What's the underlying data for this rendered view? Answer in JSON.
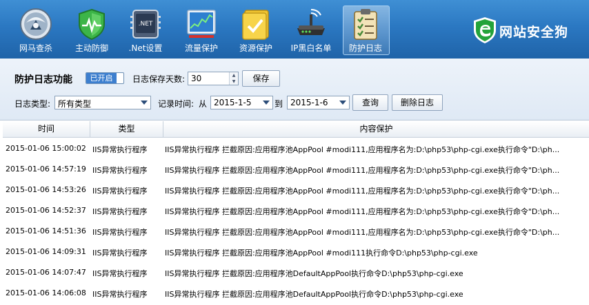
{
  "toolbar": {
    "items": [
      {
        "label": "网马查杀",
        "icon": "shield-globe-icon"
      },
      {
        "label": "主动防御",
        "icon": "green-shield-icon"
      },
      {
        "label": ".Net设置",
        "icon": "dotnet-chip-icon"
      },
      {
        "label": "流量保护",
        "icon": "traffic-chart-icon"
      },
      {
        "label": "资源保护",
        "icon": "folder-check-icon"
      },
      {
        "label": "IP黑白名单",
        "icon": "router-icon"
      },
      {
        "label": "防护日志",
        "icon": "clipboard-checklist-icon"
      }
    ],
    "active_index": 6,
    "brand": "网站安全狗"
  },
  "panel": {
    "title": "防护日志功能",
    "toggle_label": "已开启",
    "days_label": "日志保存天数:",
    "days_value": "30",
    "save_label": "保存",
    "type_label": "日志类型:",
    "type_value": "所有类型",
    "time_label": "记录时间:",
    "from_label": "从",
    "from_value": "2015-1-5",
    "to_label": "到",
    "to_value": "2015-1-6",
    "query_label": "查询",
    "delete_label": "删除日志"
  },
  "table": {
    "columns": [
      "时间",
      "类型",
      "内容保护"
    ],
    "rows": [
      {
        "time": "2015-01-06 15:00:02",
        "type": "IIS异常执行程序",
        "content": "IIS异常执行程序 拦截原因:应用程序池AppPool #modi111,应用程序名为:D:\\php53\\php-cgi.exe执行命令\"D:\\ph..."
      },
      {
        "time": "2015-01-06 14:57:19",
        "type": "IIS异常执行程序",
        "content": "IIS异常执行程序 拦截原因:应用程序池AppPool #modi111,应用程序名为:D:\\php53\\php-cgi.exe执行命令\"D:\\ph..."
      },
      {
        "time": "2015-01-06 14:53:26",
        "type": "IIS异常执行程序",
        "content": "IIS异常执行程序 拦截原因:应用程序池AppPool #modi111,应用程序名为:D:\\php53\\php-cgi.exe执行命令\"D:\\ph..."
      },
      {
        "time": "2015-01-06 14:52:37",
        "type": "IIS异常执行程序",
        "content": "IIS异常执行程序 拦截原因:应用程序池AppPool #modi111,应用程序名为:D:\\php53\\php-cgi.exe执行命令\"D:\\ph..."
      },
      {
        "time": "2015-01-06 14:51:36",
        "type": "IIS异常执行程序",
        "content": "IIS异常执行程序 拦截原因:应用程序池AppPool #modi111,应用程序名为:D:\\php53\\php-cgi.exe执行命令\"D:\\ph..."
      },
      {
        "time": "2015-01-06 14:09:31",
        "type": "IIS异常执行程序",
        "content": "IIS异常执行程序 拦截原因:应用程序池AppPool #modi111执行命令D:\\php53\\php-cgi.exe"
      },
      {
        "time": "2015-01-06 14:07:47",
        "type": "IIS异常执行程序",
        "content": "IIS异常执行程序 拦截原因:应用程序池DefaultAppPool执行命令D:\\php53\\php-cgi.exe"
      },
      {
        "time": "2015-01-06 14:06:08",
        "type": "IIS异常执行程序",
        "content": "IIS异常执行程序 拦截原因:应用程序池DefaultAppPool执行命令D:\\php53\\php-cgi.exe"
      }
    ]
  },
  "colors": {
    "toolbar_top": "#3f8fd4",
    "toolbar_bottom": "#1f63a8",
    "toggle_on": "#3d7fcf",
    "panel_bg": "#e6eef7"
  }
}
